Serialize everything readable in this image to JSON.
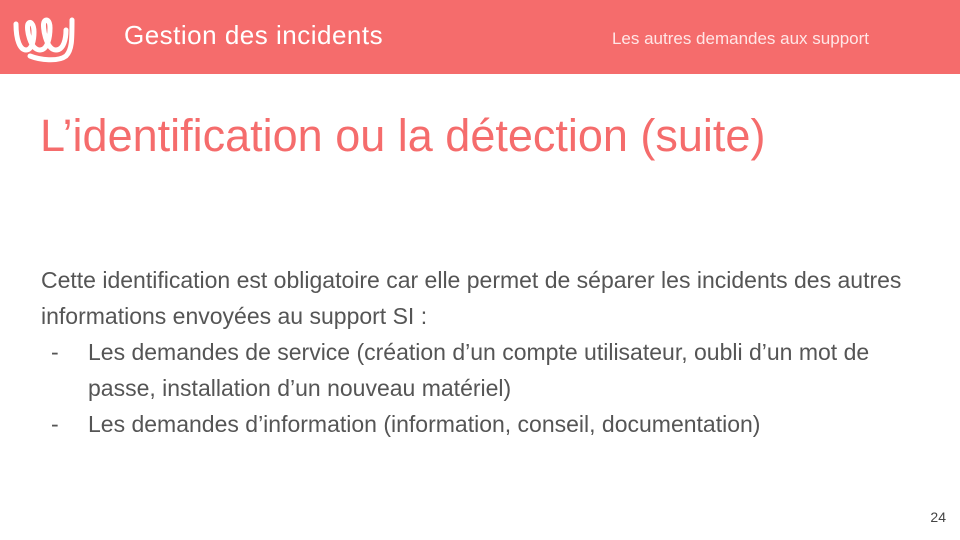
{
  "header": {
    "title": "Gestion des incidents",
    "subtitle": "Les autres demandes aux support",
    "logo_icon": "wave-logo-icon",
    "background_color": "#f56c6c"
  },
  "slide": {
    "title": "L’identification ou la détection (suite)",
    "title_color": "#f56c6c",
    "intro": "Cette identification est obligatoire car elle permet de séparer les incidents des autres informations envoyées au support SI :",
    "bullets": [
      {
        "marker": "-",
        "text": "Les demandes de service (création d’un compte utilisateur, oubli d’un mot de passe, installation d’un nouveau matériel)"
      },
      {
        "marker": "-",
        "text": "Les demandes d’information (information, conseil, documentation)"
      }
    ]
  },
  "footer": {
    "page_number": "24"
  }
}
